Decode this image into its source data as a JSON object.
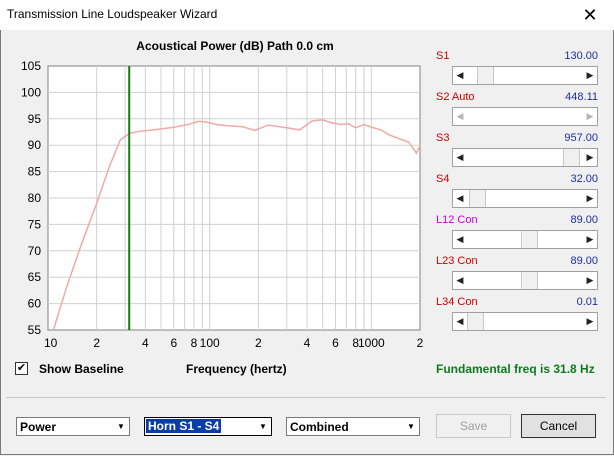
{
  "window": {
    "title": "Transmission Line Loudspeaker Wizard",
    "close_glyph": "✕"
  },
  "plot": {
    "title": "Acoustical Power (dB)   Path 0.0 cm",
    "xlabel": "Frequency (hertz)",
    "background": "#ffffff",
    "curve_color": "#f0a8a8",
    "marker_color": "#117a11",
    "marker_freq": 31.8,
    "y_ticks": [
      "105",
      "100",
      "95",
      "90",
      "85",
      "80",
      "75",
      "70",
      "65",
      "60",
      "55"
    ],
    "x_tick_labels": [
      {
        "f": 10,
        "label": "10"
      },
      {
        "f": 20,
        "label": "2"
      },
      {
        "f": 40,
        "label": "4"
      },
      {
        "f": 60,
        "label": "6"
      },
      {
        "f": 80,
        "label": "8"
      },
      {
        "f": 100,
        "label": "100"
      },
      {
        "f": 200,
        "label": "2"
      },
      {
        "f": 400,
        "label": "4"
      },
      {
        "f": 600,
        "label": "6"
      },
      {
        "f": 800,
        "label": "8"
      },
      {
        "f": 1000,
        "label": "1000"
      },
      {
        "f": 2000,
        "label": "2"
      }
    ]
  },
  "chart_data": {
    "type": "line",
    "title": "Acoustical Power (dB)   Path 0.0 cm",
    "xlabel": "Frequency (hertz)",
    "ylabel": "",
    "xscale": "log",
    "xlim": [
      10,
      2000
    ],
    "ylim": [
      55,
      105
    ],
    "series": [
      {
        "x": [
          10.8,
          13,
          16,
          20,
          24,
          28,
          31.8,
          36,
          45,
          60,
          75,
          85,
          95,
          110,
          130,
          160,
          190,
          230,
          300,
          360,
          430,
          500,
          560,
          650,
          720,
          800,
          900,
          1000,
          1150,
          1300,
          1500,
          1700,
          1900,
          2000
        ],
        "y": [
          55,
          63,
          71,
          79,
          86,
          91,
          92.2,
          92.6,
          92.9,
          93.4,
          94,
          94.5,
          94.4,
          93.9,
          93.7,
          93.5,
          92.8,
          93.8,
          93.3,
          92.9,
          94.6,
          94.8,
          94.3,
          93.9,
          94.1,
          93.3,
          93.9,
          93.4,
          92.9,
          91.9,
          91.2,
          90.6,
          88.5,
          89.9
        ]
      }
    ],
    "vertical_marker_x": 31.8,
    "grid": true
  },
  "sliders": [
    {
      "label": "S1",
      "value": "130.00",
      "label_color": "#cc0000",
      "pos": 0.1,
      "left_disabled": false,
      "right_disabled": false
    },
    {
      "label": "S2  Auto",
      "value": "448.11",
      "label_color": "#cc0000",
      "pos": 0.9,
      "left_disabled": true,
      "right_disabled": true,
      "hide_thumb": true
    },
    {
      "label": "S3",
      "value": "957.00",
      "label_color": "#cc0000",
      "pos": 0.97,
      "left_disabled": false,
      "right_disabled": false
    },
    {
      "label": "S4",
      "value": "32.00",
      "label_color": "#cc0000",
      "pos": 0.02,
      "left_disabled": false,
      "right_disabled": false
    },
    {
      "label": "L12  Con",
      "value": "89.00",
      "label_color": "#cc00cc",
      "pos": 0.55,
      "left_disabled": false,
      "right_disabled": false
    },
    {
      "label": "L23  Con",
      "value": "89.00",
      "label_color": "#cc0000",
      "pos": 0.55,
      "left_disabled": false,
      "right_disabled": false
    },
    {
      "label": "L34  Con",
      "value": "0.01",
      "label_color": "#cc0000",
      "pos": 0.0,
      "left_disabled": false,
      "right_disabled": false
    }
  ],
  "show_baseline": {
    "label": "Show Baseline",
    "checked": true,
    "check_glyph": "✔"
  },
  "fundamental": "Fundamental freq is 31.8 Hz",
  "selects": {
    "power": "Power",
    "horn": "Horn S1 - S4",
    "combined": "Combined"
  },
  "buttons": {
    "save": "Save",
    "cancel": "Cancel"
  },
  "icons": {
    "dropdown": "▼",
    "left": "◀",
    "right": "▶"
  }
}
